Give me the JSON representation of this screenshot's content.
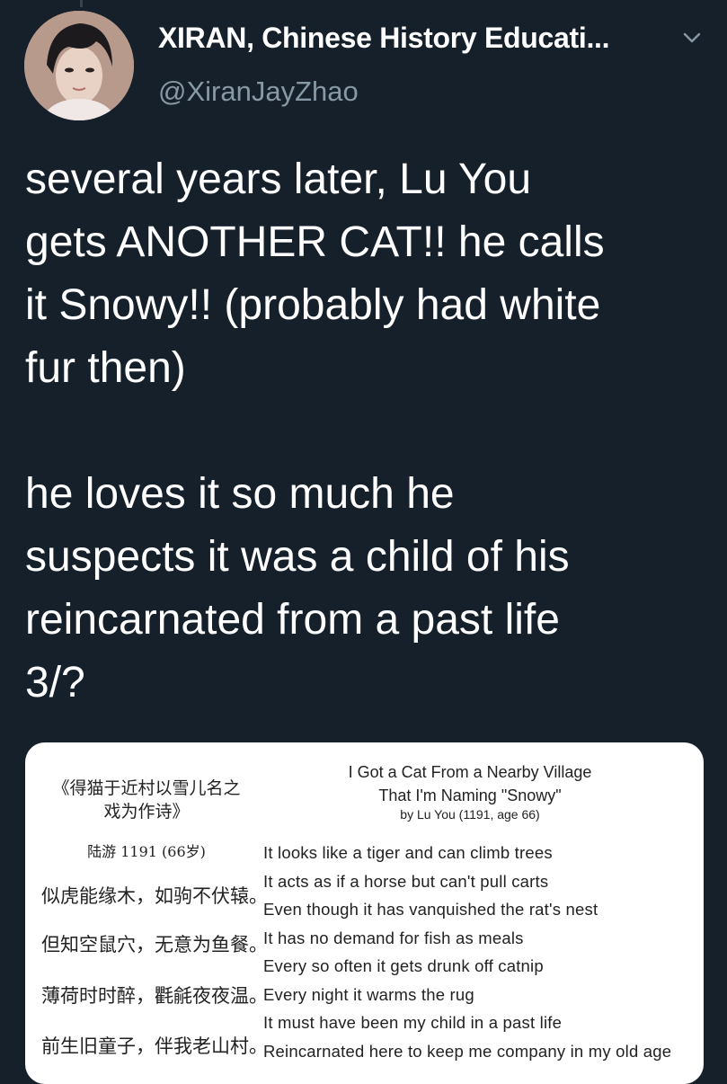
{
  "tweet": {
    "display_name": "XIRAN, Chinese History Educati...",
    "handle": "@XiranJayZhao",
    "text": "several years later, Lu You\ngets ANOTHER CAT!! he calls\nit Snowy!! (probably had white\nfur then)\n\nhe loves it so much he\nsuspects it was a child of his\nreincarnated from a past life\n3/?"
  },
  "icons": {
    "avatar": "avatar",
    "menu": "chevron-down-icon"
  },
  "poem": {
    "chinese_title": "《得猫于近村以雪儿名之\n戏为作诗》",
    "chinese_author": "陆游 1191 (66岁)",
    "chinese_lines": [
      "似虎能缘木，如驹不伏辕。",
      "但知空鼠穴，无意为鱼餐。",
      "薄荷时时醉，氍毹夜夜温。",
      "前生旧童子，伴我老山村。"
    ],
    "english_title": "I Got a Cat From a Nearby Village\nThat I'm Naming \"Snowy\"",
    "english_byline": "by Lu You (1191, age 66)",
    "english_lines": [
      "It looks like a tiger and can climb trees",
      "It acts as if a horse but can't pull carts",
      "Even though it has vanquished the rat's nest",
      "It has no demand for fish as meals",
      "Every so often it gets drunk off catnip",
      "Every night it warms the rug",
      "It must have been my child in a past life",
      "Reincarnated here to keep me company in my old age"
    ]
  },
  "colors": {
    "background": "#15202b",
    "text": "#ffffff",
    "secondary_text": "#8899a6",
    "card": "#ffffff"
  }
}
